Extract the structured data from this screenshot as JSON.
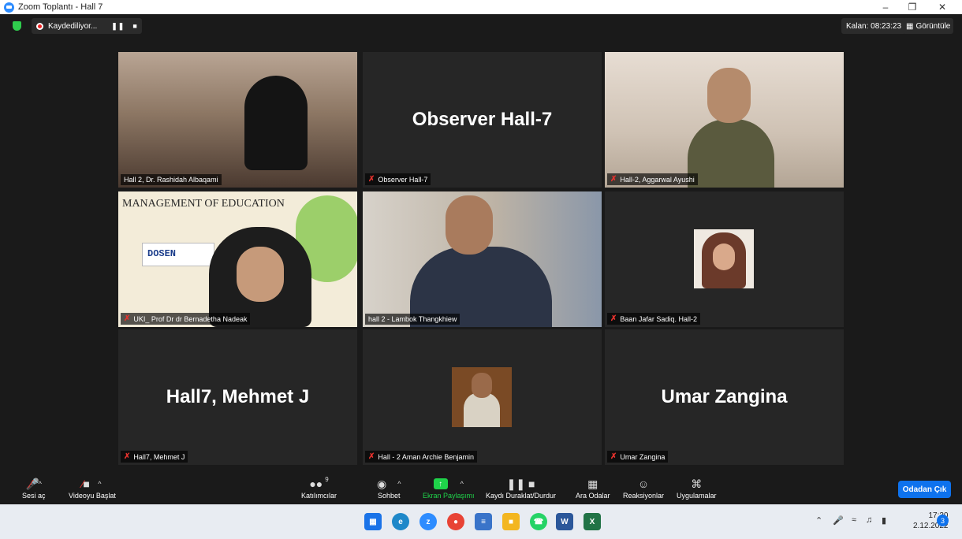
{
  "window": {
    "title": "Zoom Toplantı - Hall 7"
  },
  "topbar": {
    "recording_label": "Kaydediliyor...",
    "time_left": "Kalan: 08:23:23",
    "view_label": "Görüntüle"
  },
  "tiles": [
    {
      "label": "Hall 2, Dr. Rashidah Albaqami",
      "big": ""
    },
    {
      "label": "Observer Hall-7",
      "big": "Observer Hall-7"
    },
    {
      "label": "Hall-2, Aggarwal Ayushi",
      "big": ""
    },
    {
      "label": "UKI_ Prof Dr dr Bernadetha Nadeak",
      "big": ""
    },
    {
      "label": "hall 2 - Lambok Thangkhiew",
      "big": ""
    },
    {
      "label": "Baan Jafar Sadiq. Hall-2",
      "big": ""
    },
    {
      "label": "Hall7, Mehmet J",
      "big": "Hall7, Mehmet J"
    },
    {
      "label": "Hall - 2 Aman Archie Benjamin",
      "big": ""
    },
    {
      "label": "Umar Zangina",
      "big": "Umar Zangina"
    }
  ],
  "slide_text": {
    "title": "MANAGEMENT OF EDUCATION",
    "box": "DOSEN"
  },
  "controls": {
    "unmute": "Sesi aç",
    "start_video": "Videoyu Başlat",
    "participants": "Katılımcılar",
    "participants_count": "9",
    "chat": "Sohbet",
    "share": "Ekran Paylaşımı",
    "pause_record": "Kaydı Duraklat/Durdur",
    "breakout": "Ara Odalar",
    "reactions": "Reaksiyonlar",
    "apps": "Uygulamalar",
    "leave": "Odadan Çık"
  },
  "taskbar": {
    "time": "17:30",
    "date": "2.12.2022",
    "notifications": "3"
  },
  "colors": {
    "accent": "#0e72ed",
    "active_speaker": "#c8e65a",
    "share_green": "#1fd34a",
    "mute_red": "#e5322d"
  }
}
